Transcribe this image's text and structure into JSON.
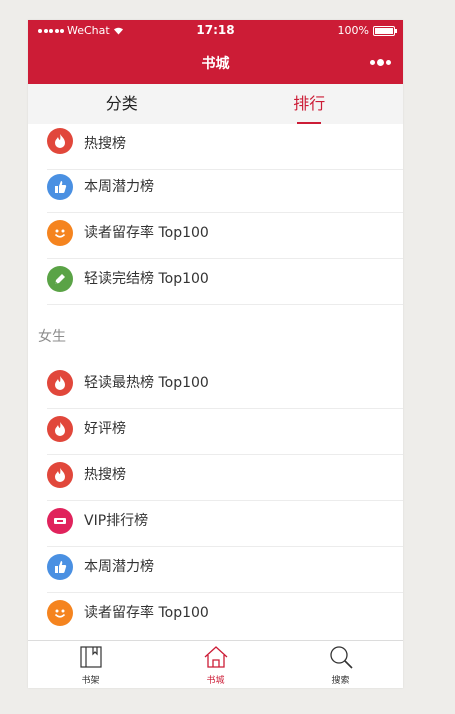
{
  "status": {
    "carrier": "WeChat",
    "time": "17:18",
    "battery": "100%"
  },
  "navbar": {
    "title": "书城"
  },
  "tabs": [
    {
      "label": "分类",
      "active": false
    },
    {
      "label": "排行",
      "active": true
    }
  ],
  "list_top": [
    {
      "label": "热搜榜",
      "icon": "fire-icon",
      "color": "#e1473b"
    },
    {
      "label": "本周潜力榜",
      "icon": "thumbs-up-icon",
      "color": "#4a90e2"
    },
    {
      "label": "读者留存率 Top100",
      "icon": "smile-icon",
      "color": "#f5841f"
    },
    {
      "label": "轻读完结榜 Top100",
      "icon": "pen-icon",
      "color": "#5aa346"
    }
  ],
  "section_female": "女生",
  "list_female": [
    {
      "label": "轻读最热榜 Top100",
      "icon": "fire-icon",
      "color": "#e1473b"
    },
    {
      "label": "好评榜",
      "icon": "fire-icon",
      "color": "#e1473b"
    },
    {
      "label": "热搜榜",
      "icon": "fire-icon",
      "color": "#e1473b"
    },
    {
      "label": "VIP排行榜",
      "icon": "ticket-icon",
      "color": "#e0235c"
    },
    {
      "label": "本周潜力榜",
      "icon": "thumbs-up-icon",
      "color": "#4a90e2"
    },
    {
      "label": "读者留存率 Top100",
      "icon": "smile-icon",
      "color": "#f5841f"
    }
  ],
  "bottom_tabs": [
    {
      "label": "书架",
      "icon": "bookshelf-icon",
      "active": false
    },
    {
      "label": "书城",
      "icon": "home-icon",
      "active": true
    },
    {
      "label": "搜索",
      "icon": "search-icon",
      "active": false
    }
  ],
  "colors": {
    "brand": "#cc1c36",
    "background": "#eeedea"
  }
}
